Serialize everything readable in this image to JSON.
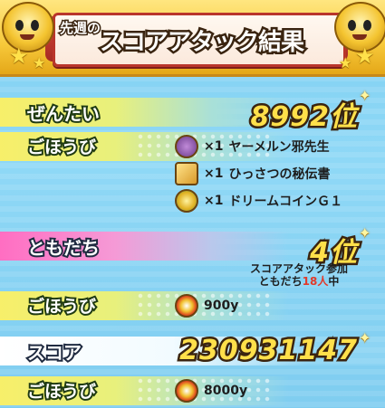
{
  "header": {
    "prefix": "先週の",
    "title": "スコアアタック結果"
  },
  "overall": {
    "label": "ぜんたい",
    "rank": "8992位",
    "rewards_label": "ごほうび",
    "rewards": [
      {
        "qty": "×1",
        "name": "ヤーメルン邪先生",
        "icon": "purple-yokai-icon"
      },
      {
        "qty": "×1",
        "name": "ひっさつの秘伝書",
        "icon": "scroll-book-icon"
      },
      {
        "qty": "×1",
        "name": "ドリームコインＧ１",
        "icon": "gold-coin-icon"
      }
    ]
  },
  "friends": {
    "label": "ともだち",
    "rank": "4位",
    "note_line1": "スコアアタック参加",
    "note_prefix": "ともだち",
    "note_count": "18人",
    "note_suffix": "中",
    "rewards_label": "ごほうび",
    "reward_amount": "900y"
  },
  "score": {
    "label": "スコア",
    "value": "230931147",
    "rewards_label": "ごほうび",
    "reward_amount": "8000y"
  },
  "colors": {
    "bar_yellow": "#f7ef6a",
    "bar_pink": "#ff6ec2",
    "number_gold": "#ffe04a",
    "highlight_red": "#e23a2a"
  }
}
